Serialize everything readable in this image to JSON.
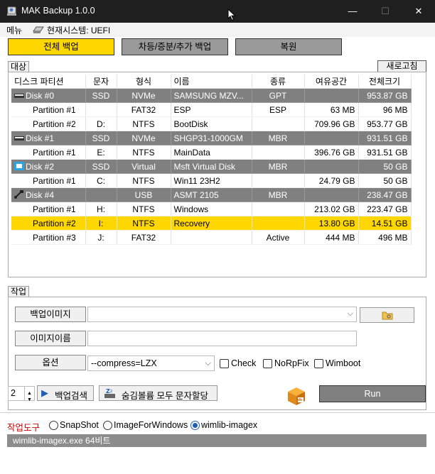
{
  "window": {
    "title": "MAK Backup 1.0.0"
  },
  "menu": {
    "menu_label": "메뉴",
    "system_label": "현재시스템: UEFI"
  },
  "top_buttons": {
    "full_backup": "전체 백업",
    "auto_backup": "차등/증분/추가 백업",
    "restore": "복원"
  },
  "target": {
    "tab_label": "대상",
    "refresh_label": "새로고침",
    "columns": [
      "디스크 파티션",
      "문자",
      "형식",
      "이름",
      "종류",
      "여유공간",
      "전체크기"
    ],
    "rows": [
      {
        "kind": "disk",
        "icon": "hdd",
        "cells": [
          "Disk #0",
          "SSD",
          "NVMe",
          "SAMSUNG MZV...",
          "GPT",
          "",
          "953.87 GB"
        ]
      },
      {
        "kind": "part",
        "cells": [
          "Partition #1",
          "",
          "FAT32",
          "ESP",
          "ESP",
          "63 MB",
          "96 MB"
        ]
      },
      {
        "kind": "part",
        "cells": [
          "Partition #2",
          "D:",
          "NTFS",
          "BootDisk",
          "",
          "709.96 GB",
          "953.77 GB"
        ]
      },
      {
        "kind": "disk",
        "icon": "hdd",
        "cells": [
          "Disk #1",
          "SSD",
          "NVMe",
          "SHGP31-1000GM",
          "MBR",
          "",
          "931.51 GB"
        ]
      },
      {
        "kind": "part",
        "cells": [
          "Partition #1",
          "E:",
          "NTFS",
          "MainData",
          "",
          "396.76 GB",
          "931.51 GB"
        ]
      },
      {
        "kind": "disk",
        "icon": "vhd",
        "cells": [
          "Disk #2",
          "SSD",
          "Virtual",
          "Msft Virtual Disk",
          "MBR",
          "",
          "50 GB"
        ]
      },
      {
        "kind": "part",
        "cells": [
          "Partition #1",
          "C:",
          "NTFS",
          "Win11 23H2",
          "",
          "24.79 GB",
          "50 GB"
        ]
      },
      {
        "kind": "disk",
        "icon": "usb",
        "cells": [
          "Disk #4",
          "",
          "USB",
          "ASMT 2105",
          "MBR",
          "",
          "238.47 GB"
        ]
      },
      {
        "kind": "part",
        "cells": [
          "Partition #1",
          "H:",
          "NTFS",
          "Windows",
          "",
          "213.02 GB",
          "223.47 GB"
        ]
      },
      {
        "kind": "sel",
        "cells": [
          "Partition #2",
          "I:",
          "NTFS",
          "Recovery",
          "",
          "13.80 GB",
          "14.51 GB"
        ]
      },
      {
        "kind": "part",
        "cells": [
          "Partition #3",
          "J:",
          "FAT32",
          "",
          "Active",
          "444 MB",
          "496 MB"
        ]
      }
    ]
  },
  "work": {
    "tab_label": "작업",
    "backup_image_label": "백업이미지",
    "image_name_label": "이미지이름",
    "options_label": "옵션",
    "options_value": "--compress=LZX",
    "check_labels": [
      "Check",
      "NoRpFix",
      "Wimboot"
    ],
    "spin_value": "2",
    "search_label": "백업검색",
    "assign_label": "숨김볼륨 모두 문자할당",
    "run_label": "Run"
  },
  "tools": {
    "label": "작업도구",
    "options": [
      "SnapShot",
      "ImageForWindows",
      "wimlib-imagex"
    ],
    "selected": "wimlib-imagex"
  },
  "status": {
    "text": "wimlib-imagex.exe 64비트"
  },
  "colors": {
    "accent": "#ffd700",
    "disk_row": "#808080",
    "titlebar": "#1f1f1f",
    "tool_label": "#cc0000"
  }
}
